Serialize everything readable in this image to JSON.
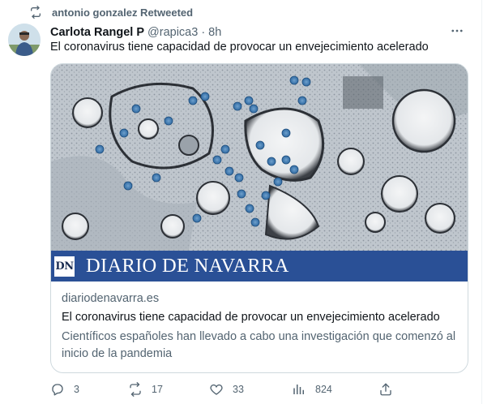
{
  "retweet_banner": {
    "text": "antonio gonzalez Retweeted"
  },
  "tweet": {
    "display_name": "Carlota Rangel P",
    "handle": "@rapica3",
    "separator": "·",
    "time": "8h",
    "text": "El coronavirus tiene capacidad de provocar un envejecimiento acelerado"
  },
  "card": {
    "logo_mark": "DN",
    "brand": "DIARIO DE NAVARRA",
    "domain": "diariodenavarra.es",
    "title": "El coronavirus tiene capacidad de provocar un envejecimiento acelerado",
    "description": "Científicos españoles han llevado a cabo una investigación que comenzó al inicio de la pandemia"
  },
  "actions": {
    "replies": "3",
    "retweets": "17",
    "likes": "33",
    "views": "824"
  },
  "colors": {
    "banner_bg": "#2a5096",
    "secondary_text": "#536471",
    "primary_text": "#0f1419",
    "border": "#cfd9de"
  },
  "icons": [
    "retweet-icon",
    "more-icon",
    "reply-icon",
    "like-icon",
    "views-icon",
    "share-icon"
  ]
}
